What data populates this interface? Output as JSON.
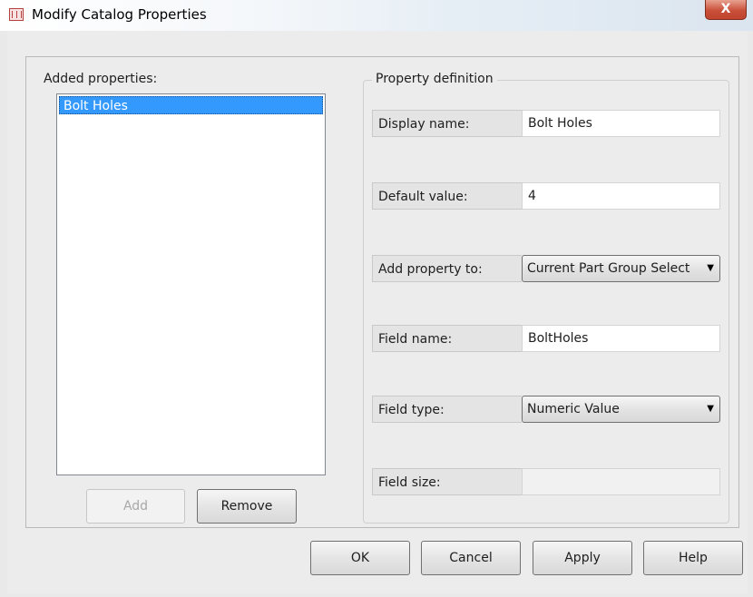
{
  "window": {
    "title": "Modify Catalog Properties",
    "close_glyph": "X"
  },
  "left_panel": {
    "heading": "Added properties:",
    "items": [
      "Bolt Holes"
    ],
    "selected_index": 0,
    "add_label": "Add",
    "remove_label": "Remove"
  },
  "definition": {
    "legend": "Property definition",
    "display_name": {
      "label": "Display name:",
      "value": "Bolt Holes"
    },
    "default_value": {
      "label": "Default value:",
      "value": "4"
    },
    "add_property_to": {
      "label": "Add property to:",
      "value": "Current Part Group Selecti"
    },
    "field_name": {
      "label": "Field name:",
      "value": "BoltHoles"
    },
    "field_type": {
      "label": "Field type:",
      "value": "Numeric Value"
    },
    "field_size": {
      "label": "Field size:",
      "value": ""
    }
  },
  "footer": {
    "ok_label": "OK",
    "cancel_label": "Cancel",
    "apply_label": "Apply",
    "help_label": "Help"
  },
  "colors": {
    "selection": "#3399ff",
    "close_button": "#c9503a"
  }
}
